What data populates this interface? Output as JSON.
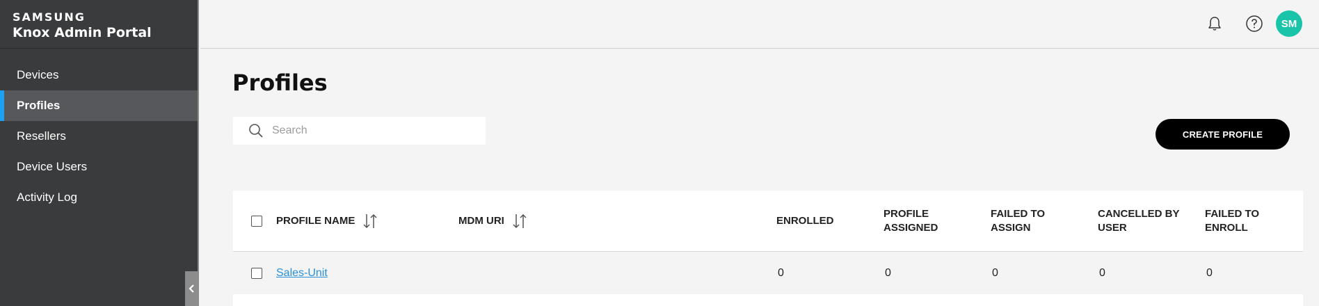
{
  "brand": {
    "company": "SAMSUNG",
    "product": "Knox Admin Portal"
  },
  "sidebar": {
    "items": [
      {
        "label": "Devices",
        "active": false
      },
      {
        "label": "Profiles",
        "active": true
      },
      {
        "label": "Resellers",
        "active": false
      },
      {
        "label": "Device Users",
        "active": false
      },
      {
        "label": "Activity Log",
        "active": false
      }
    ]
  },
  "header": {
    "avatar_initials": "SM",
    "icons": [
      "bell-icon",
      "help-icon"
    ]
  },
  "main": {
    "title": "Profiles",
    "search": {
      "placeholder": "Search",
      "value": ""
    },
    "create_button": "CREATE PROFILE"
  },
  "table": {
    "columns": [
      {
        "label": "PROFILE NAME",
        "sortable": true
      },
      {
        "label": "MDM URI",
        "sortable": true
      },
      {
        "label": "ENROLLED",
        "sortable": false
      },
      {
        "label": "PROFILE ASSIGNED",
        "sortable": false
      },
      {
        "label": "FAILED TO ASSIGN",
        "sortable": false
      },
      {
        "label": "CANCELLED BY USER",
        "sortable": false
      },
      {
        "label": "FAILED TO ENROLL",
        "sortable": false
      }
    ],
    "rows": [
      {
        "profile_name": "Sales-Unit",
        "mdm_uri": "",
        "enrolled": "0",
        "profile_assigned": "0",
        "failed_to_assign": "0",
        "cancelled_by_user": "0",
        "failed_to_enroll": "0"
      }
    ]
  },
  "colors": {
    "accent": "#1da1f2",
    "avatar": "#19c4a8",
    "sidebar": "#3a3b3d",
    "link": "#2a8fd8"
  }
}
